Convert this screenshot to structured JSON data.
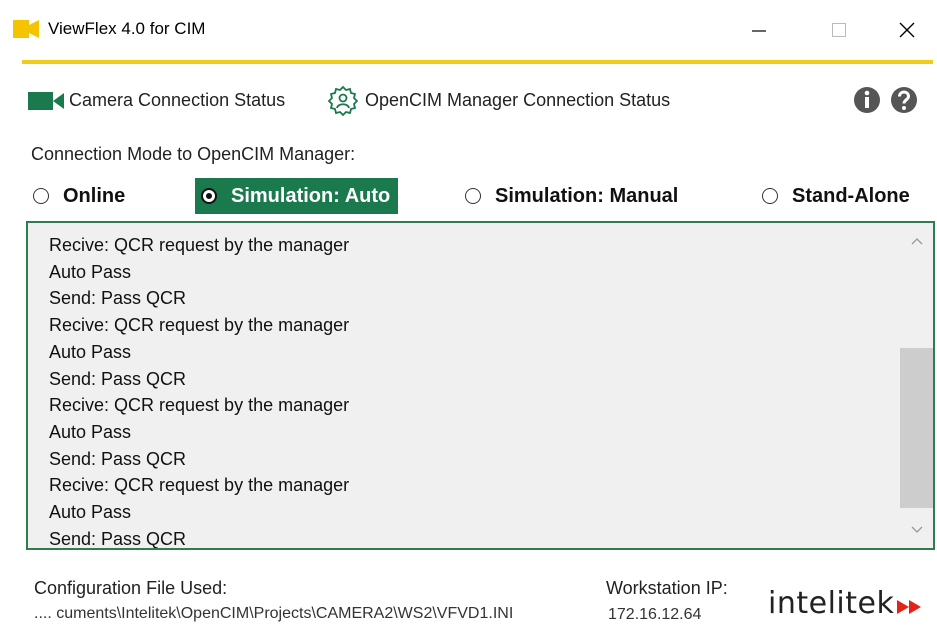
{
  "window": {
    "title": "ViewFlex 4.0 for CIM",
    "minimize_glyph": "—",
    "close_glyph": "✕"
  },
  "status": {
    "camera_label": "Camera Connection Status",
    "manager_label": "OpenCIM Manager Connection Status",
    "camera_icon": "video-camera-icon",
    "manager_icon": "gear-user-icon",
    "info_icon": "info-icon",
    "help_icon": "help-icon",
    "accent_color": "#1b7a4d"
  },
  "mode": {
    "label": "Connection Mode to OpenCIM Manager:",
    "options": [
      {
        "label": "Online",
        "selected": false
      },
      {
        "label": "Simulation: Auto",
        "selected": true
      },
      {
        "label": "Simulation: Manual",
        "selected": false
      },
      {
        "label": "Stand-Alone",
        "selected": false
      }
    ]
  },
  "log": {
    "lines": [
      "Recive: QCR request by the manager",
      "Auto Pass",
      "Send: Pass QCR",
      "Recive: QCR request by the manager",
      "Auto Pass",
      "Send: Pass QCR",
      "Recive: QCR request by the manager",
      "Auto Pass",
      "Send: Pass QCR",
      "Recive: QCR request by the manager",
      "Auto Pass",
      "Send: Pass QCR"
    ]
  },
  "footer": {
    "config_label": "Configuration File Used:",
    "config_path": ".... cuments\\Intelitek\\OpenCIM\\Projects\\CAMERA2\\WS2\\VFVD1.INI",
    "workstation_label": "Workstation IP:",
    "workstation_ip": "172.16.12.64",
    "logo_text": "intelitek",
    "logo_color": "#e2231a"
  }
}
